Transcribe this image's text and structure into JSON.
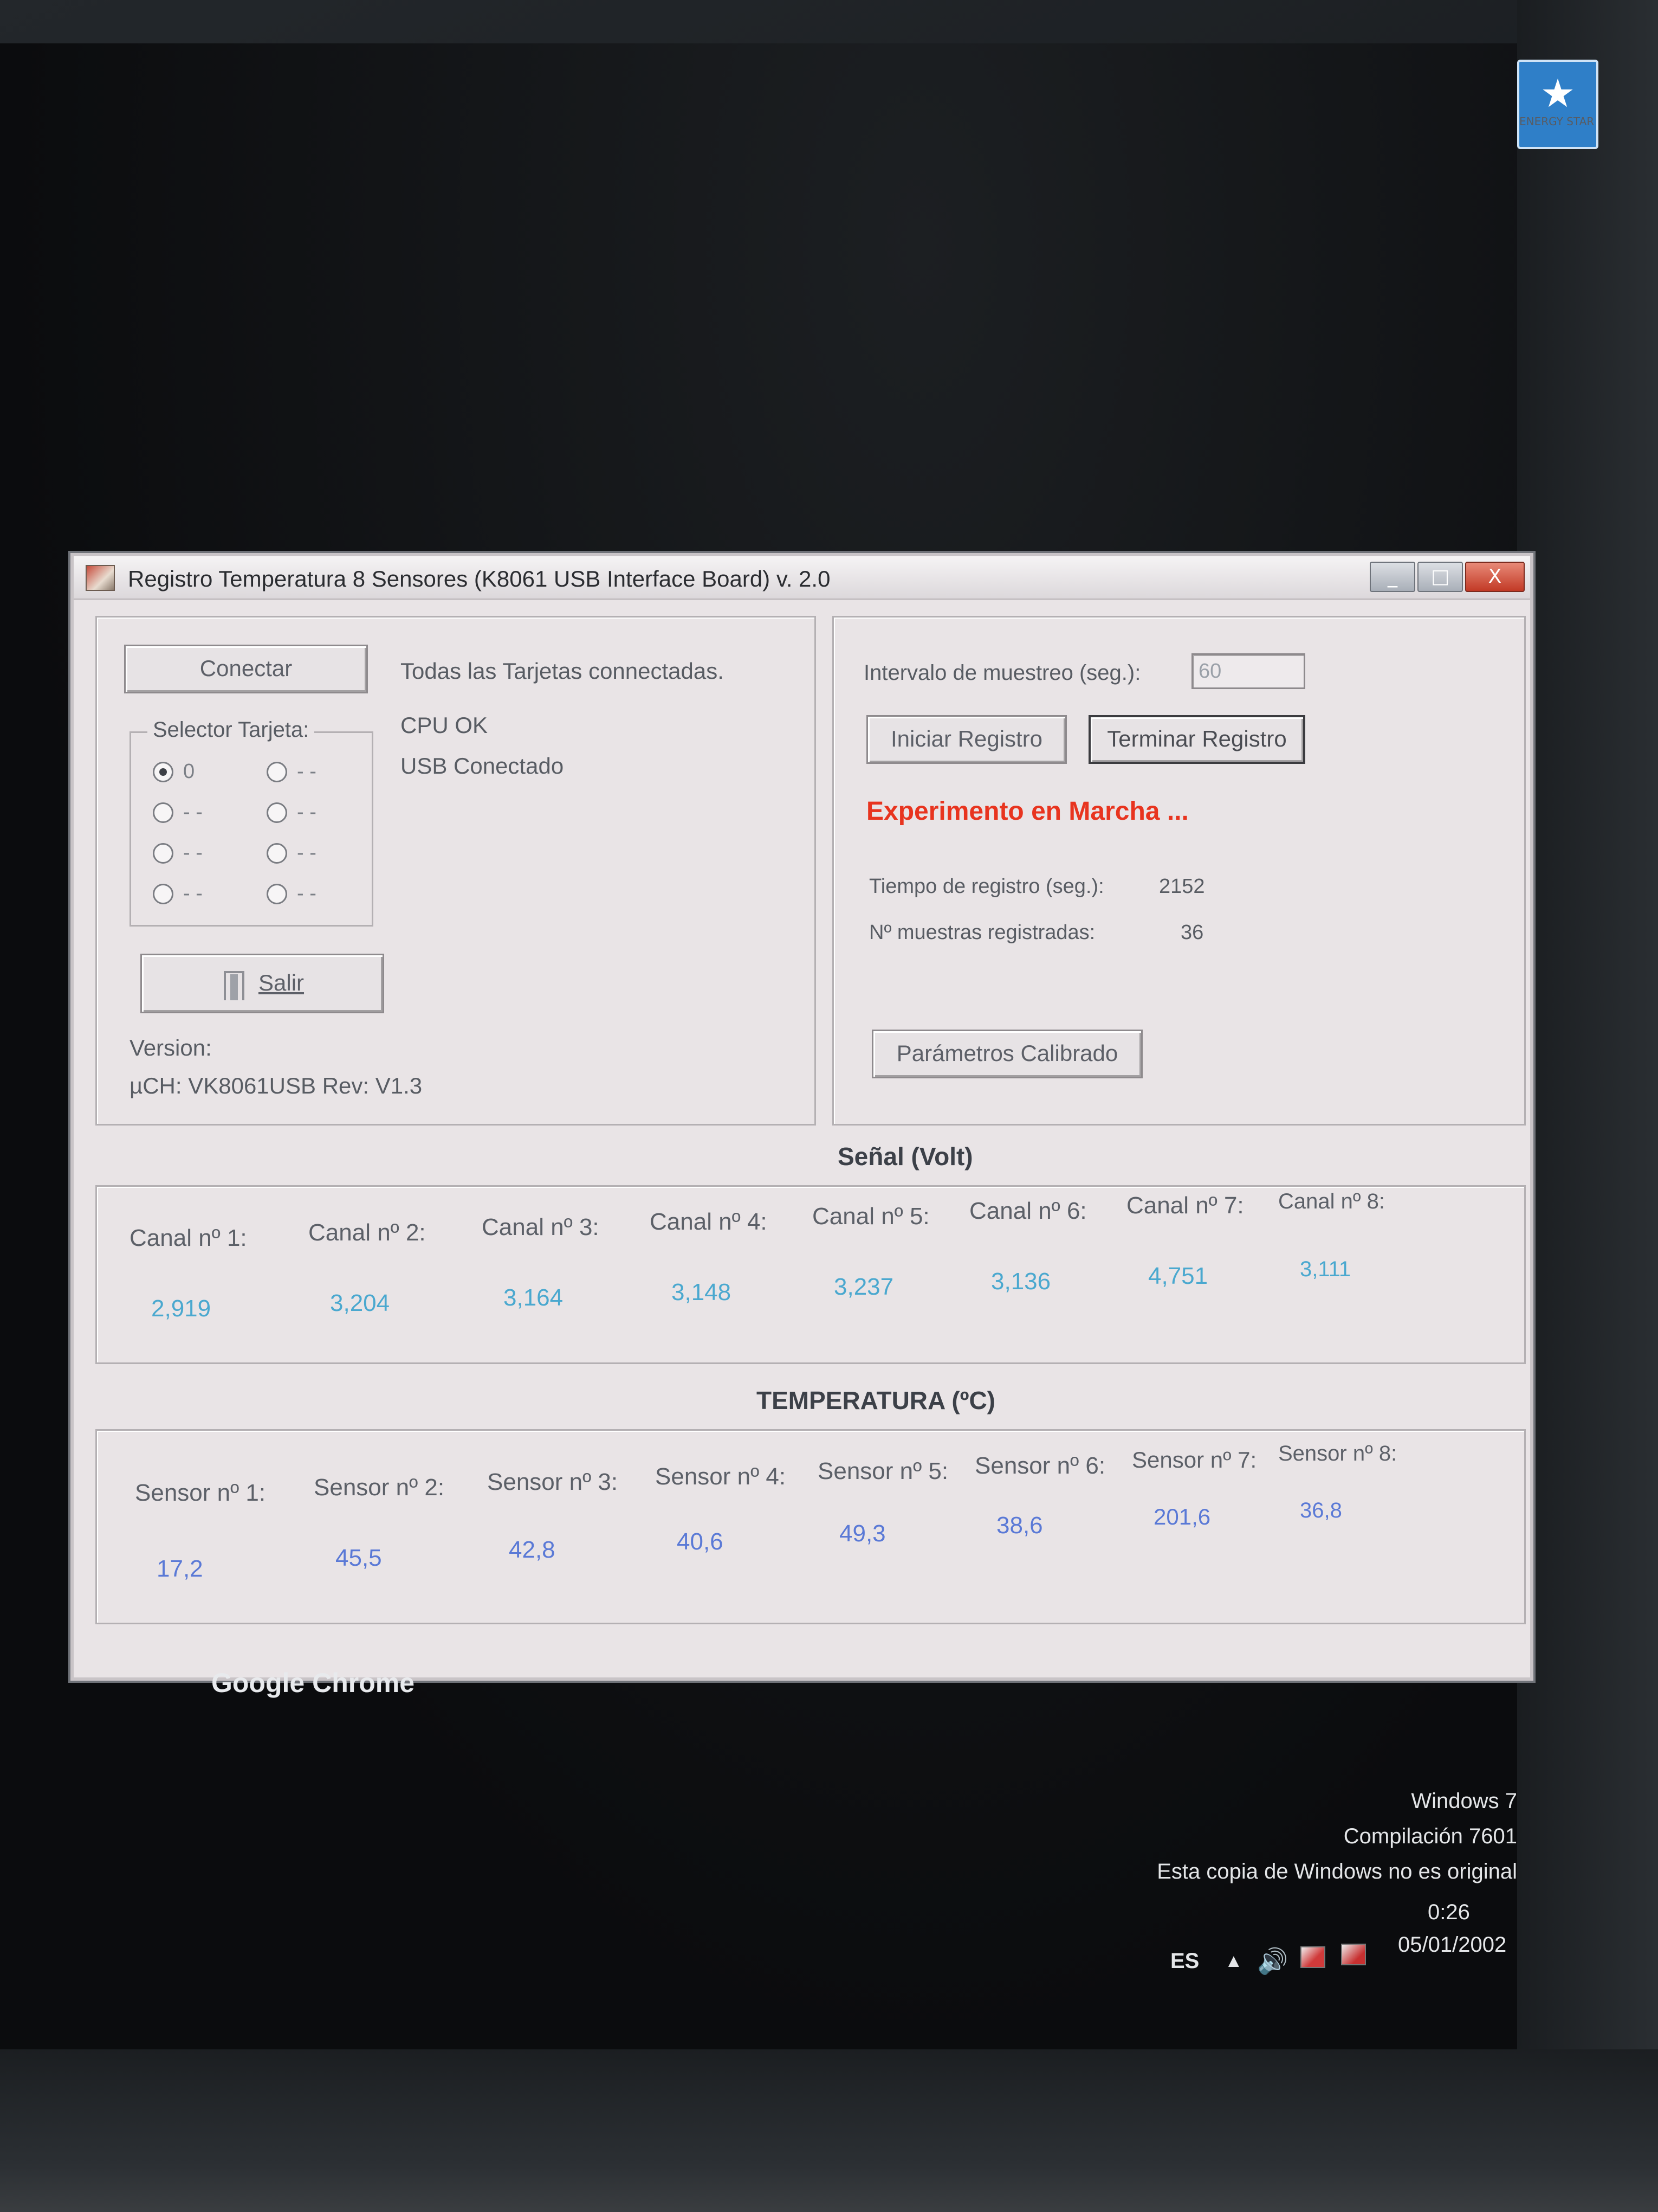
{
  "monitor": {
    "badge_text": "ENERGY STAR",
    "badge_logo": "energy"
  },
  "window": {
    "title": "Registro Temperatura 8 Sensores  (K8061 USB Interface Board)  v. 2.0",
    "controls": {
      "minimize": "_",
      "maximize": "□",
      "close": "X"
    }
  },
  "left_panel": {
    "connect_button": "Conectar",
    "connection_status": "Todas las Tarjetas connectadas.",
    "cpu_status": "CPU OK",
    "usb_status": "USB Conectado",
    "card_selector": {
      "legend": "Selector Tarjeta:",
      "options": [
        "0",
        "- -",
        "- -",
        "- -",
        "- -",
        "- -",
        "- -",
        "- -"
      ],
      "selected": "0"
    },
    "exit_button": "Salir",
    "version_label": "Version:",
    "version_value": "µCH: VK8061USB Rev: V1.3"
  },
  "right_panel": {
    "interval_label": "Intervalo de muestreo (seg.):",
    "interval_value": "60",
    "start_button": "Iniciar Registro",
    "stop_button": "Terminar Registro",
    "status_message": "Experimento en Marcha ...",
    "status_color": "#e8341f",
    "time_label": "Tiempo de registro (seg.):",
    "time_value": "2152",
    "samples_label": "Nº muestras registradas:",
    "samples_value": "36",
    "calibration_button": "Parámetros Calibrado"
  },
  "signal": {
    "title": "Señal  (Volt)",
    "channels": [
      {
        "label": "Canal nº 1:",
        "value": "2,919"
      },
      {
        "label": "Canal nº 2:",
        "value": "3,204"
      },
      {
        "label": "Canal nº 3:",
        "value": "3,164"
      },
      {
        "label": "Canal nº 4:",
        "value": "3,148"
      },
      {
        "label": "Canal nº 5:",
        "value": "3,237"
      },
      {
        "label": "Canal nº 6:",
        "value": "3,136"
      },
      {
        "label": "Canal nº 7:",
        "value": "4,751"
      },
      {
        "label": "Canal nº 8:",
        "value": "3,111"
      }
    ]
  },
  "temperature": {
    "title": "TEMPERATURA  (ºC)",
    "sensors": [
      {
        "label": "Sensor nº 1:",
        "value": "17,2"
      },
      {
        "label": "Sensor nº 2:",
        "value": "45,5"
      },
      {
        "label": "Sensor nº 3:",
        "value": "42,8"
      },
      {
        "label": "Sensor nº 4:",
        "value": "40,6"
      },
      {
        "label": "Sensor nº 5:",
        "value": "49,3"
      },
      {
        "label": "Sensor nº 6:",
        "value": "38,6"
      },
      {
        "label": "Sensor nº 7:",
        "value": "201,6"
      },
      {
        "label": "Sensor nº 8:",
        "value": "36,8"
      }
    ]
  },
  "desktop": {
    "shortcut_label": "Google Chrome",
    "os_name": "Windows 7",
    "build": "Compilación 7601",
    "genuine_notice": "Esta copia de Windows no es original"
  },
  "taskbar": {
    "language": "ES",
    "time": "0:26",
    "date": "05/01/2002"
  }
}
